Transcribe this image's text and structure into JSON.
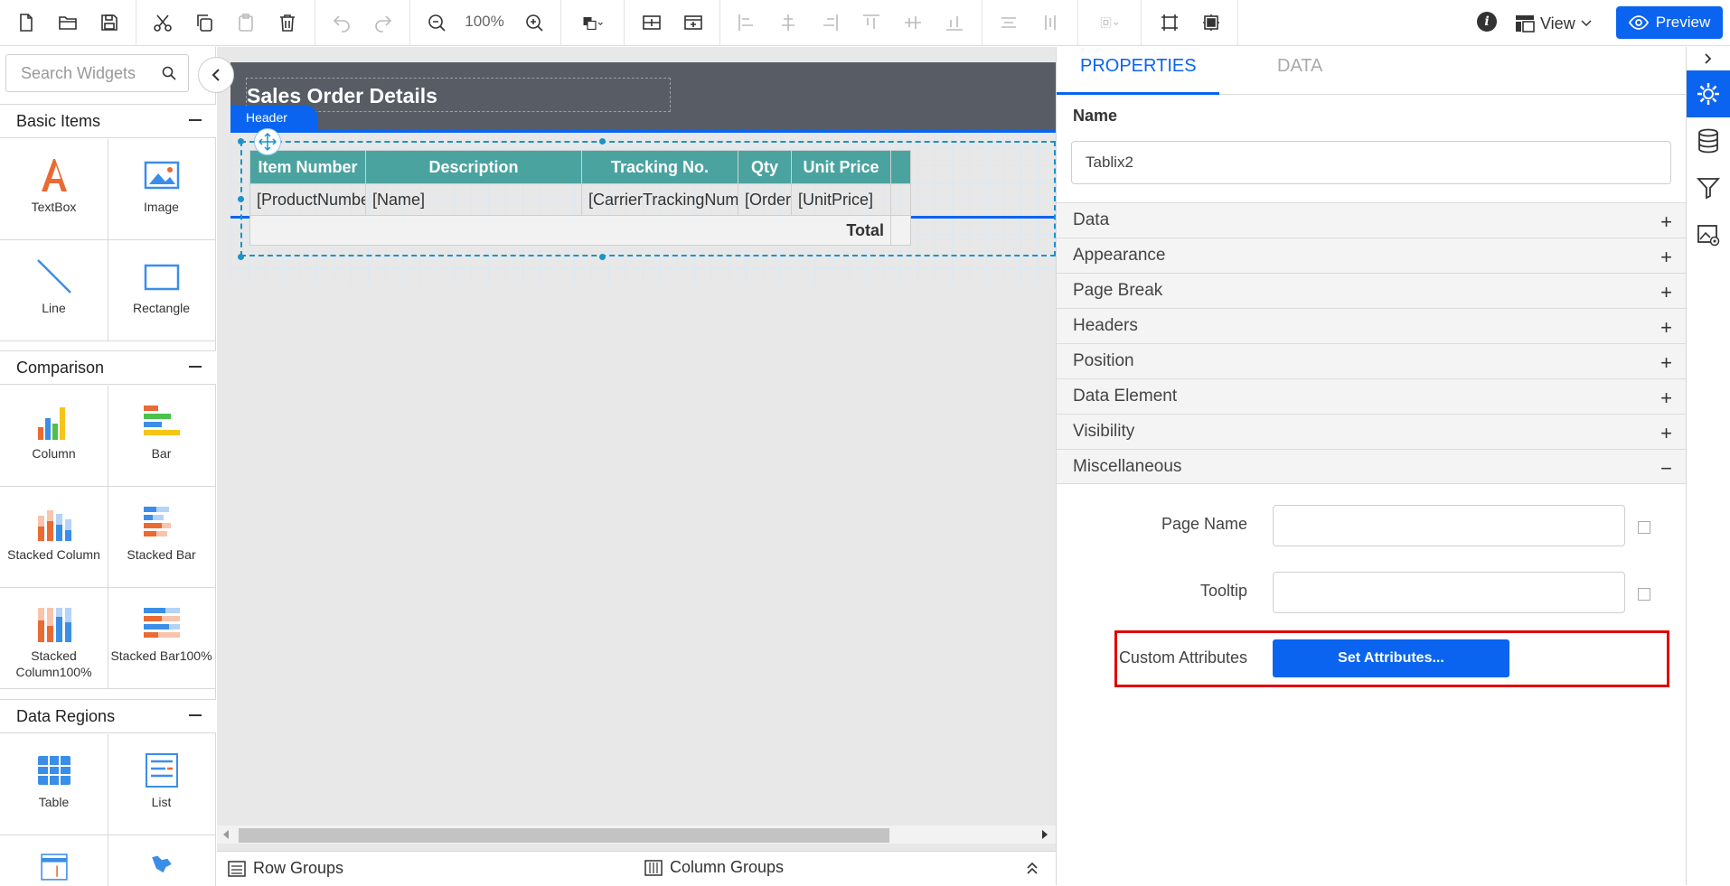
{
  "toolbar": {
    "zoom": "100%",
    "view_label": "View",
    "preview_label": "Preview",
    "info_glyph": "i",
    "icons": [
      "new-file-icon",
      "open-folder-icon",
      "save-icon",
      "cut-icon",
      "copy-icon",
      "paste-icon",
      "delete-icon",
      "undo-icon",
      "redo-icon",
      "zoom-out-icon",
      "zoom-in-icon",
      "fill-color-icon",
      "insert-row-icon",
      "insert-column-icon",
      "align-left-icon",
      "align-center-icon",
      "align-right-icon",
      "align-top-icon",
      "align-middle-icon",
      "align-bottom-icon",
      "distribute-horizontal-icon",
      "distribute-vertical-icon",
      "group-icon",
      "fit-width-icon",
      "fit-page-icon"
    ]
  },
  "left_panel": {
    "search_placeholder": "Search Widgets",
    "categories": [
      {
        "name": "Basic Items",
        "items": [
          "TextBox",
          "Image",
          "Line",
          "Rectangle"
        ]
      },
      {
        "name": "Comparison",
        "items": [
          "Column",
          "Bar",
          "Stacked Column",
          "Stacked Bar",
          "Stacked Column100%",
          "Stacked Bar100%"
        ]
      },
      {
        "name": "Data Regions",
        "items": [
          "Table",
          "List"
        ]
      }
    ]
  },
  "canvas": {
    "report_title": "Sales Order Details",
    "header_tag": "Header",
    "table": {
      "headers": [
        "Item Number",
        "Description",
        "Tracking No.",
        "Qty",
        "Unit Price",
        ""
      ],
      "row": [
        "[ProductNumber]",
        "[Name]",
        "[CarrierTrackingNumber]",
        "[OrderQty]",
        "[UnitPrice]",
        ""
      ],
      "total_label": "Total"
    }
  },
  "bottom_bar": {
    "row_groups": "Row Groups",
    "column_groups": "Column Groups"
  },
  "properties": {
    "tabs": [
      "PROPERTIES",
      "DATA"
    ],
    "active_tab": "PROPERTIES",
    "name_label": "Name",
    "name_value": "Tablix2",
    "sections": [
      {
        "label": "Data",
        "state": "+"
      },
      {
        "label": "Appearance",
        "state": "+"
      },
      {
        "label": "Page Break",
        "state": "+"
      },
      {
        "label": "Headers",
        "state": "+"
      },
      {
        "label": "Position",
        "state": "+"
      },
      {
        "label": "Data Element",
        "state": "+"
      },
      {
        "label": "Visibility",
        "state": "+"
      },
      {
        "label": "Miscellaneous",
        "state": "−"
      }
    ],
    "misc": {
      "page_name_label": "Page Name",
      "page_name_value": "",
      "tooltip_label": "Tooltip",
      "tooltip_value": "",
      "custom_attributes_label": "Custom Attributes",
      "set_attributes_button": "Set Attributes..."
    }
  },
  "colors": {
    "accent": "#0a64f0",
    "table_header": "#4ba3a0",
    "report_header": "#575c65",
    "highlight": "#e00000"
  }
}
